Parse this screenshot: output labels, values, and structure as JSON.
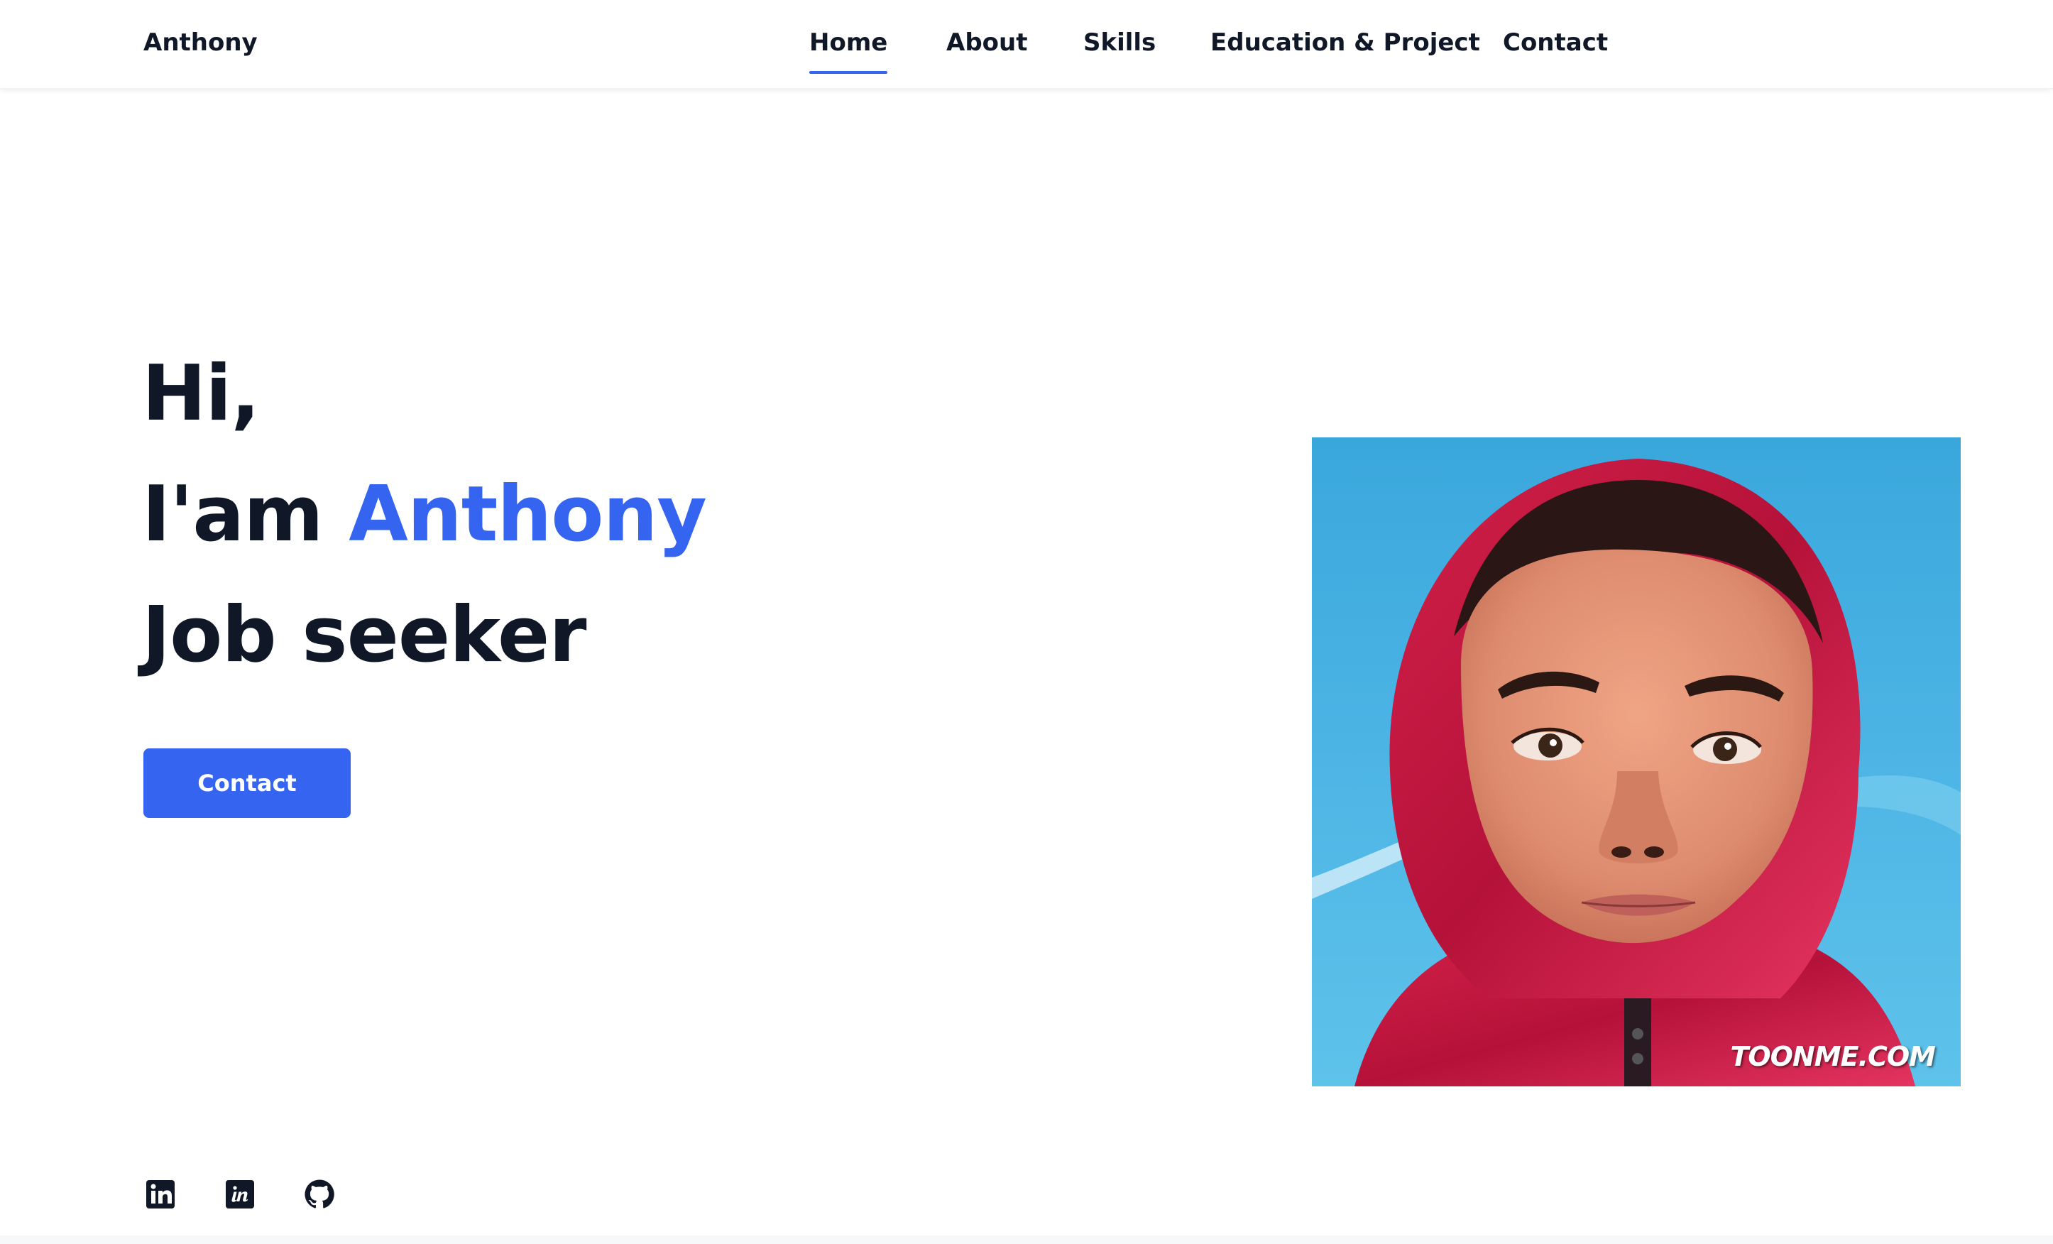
{
  "header": {
    "logo": "Anthony",
    "nav": [
      {
        "label": "Home",
        "active": true
      },
      {
        "label": "About",
        "active": false
      },
      {
        "label": "Skills",
        "active": false
      },
      {
        "label": "Education & Project",
        "active": false
      },
      {
        "label": "Contact",
        "active": false
      }
    ]
  },
  "hero": {
    "line1": "Hi,",
    "line2_prefix": "I'am ",
    "name": "Anthony",
    "line3": "Job seeker",
    "button_label": "Contact"
  },
  "social": [
    {
      "icon": "linkedin-icon"
    },
    {
      "icon": "invision-icon"
    },
    {
      "icon": "github-icon"
    }
  ],
  "portrait": {
    "watermark": "TOONME.COM"
  },
  "colors": {
    "accent": "#3464f0",
    "text": "#101828",
    "background": "#ffffff"
  }
}
